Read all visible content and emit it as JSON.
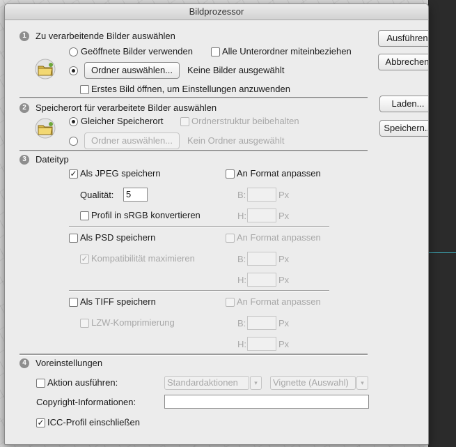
{
  "window": {
    "title": "Bildprozessor"
  },
  "side_buttons": {
    "run": "Ausführen",
    "cancel": "Abbrechen",
    "load": "Laden...",
    "save": "Speichern..."
  },
  "section1": {
    "number": "1",
    "title": "Zu verarbeitende Bilder auswählen",
    "open_images": "Geöffnete Bilder verwenden",
    "include_subfolders": "Alle Unterordner miteinbeziehen",
    "choose_folder": "Ordner auswählen...",
    "folder_status": "Keine Bilder ausgewählt",
    "open_first": "Erstes Bild öffnen, um Einstellungen anzuwenden"
  },
  "section2": {
    "number": "2",
    "title": "Speicherort für verarbeitete Bilder auswählen",
    "same_location": "Gleicher Speicherort",
    "keep_structure": "Ordnerstruktur beibehalten",
    "choose_folder": "Ordner auswählen...",
    "folder_status": "Kein Ordner ausgewählt"
  },
  "section3": {
    "number": "3",
    "title": "Dateityp",
    "jpeg": {
      "save": "Als JPEG speichern",
      "checked": true,
      "fit": "An Format anpassen",
      "quality_label": "Qualität:",
      "quality_value": "5",
      "profile": "Profil in sRGB konvertieren",
      "w_label": "B:",
      "h_label": "H:",
      "unit": "Px"
    },
    "psd": {
      "save": "Als PSD speichern",
      "fit": "An Format anpassen",
      "compat": "Kompatibilität maximieren",
      "w_label": "B:",
      "h_label": "H:",
      "unit": "Px"
    },
    "tiff": {
      "save": "Als TIFF speichern",
      "fit": "An Format anpassen",
      "lzw": "LZW-Komprimierung",
      "w_label": "B:",
      "h_label": "H:",
      "unit": "Px"
    }
  },
  "section4": {
    "number": "4",
    "title": "Voreinstellungen",
    "run_action": "Aktion ausführen:",
    "action_set": "Standardaktionen",
    "action": "Vignette (Auswahl)",
    "copyright_label": "Copyright-Informationen:",
    "copyright_value": "",
    "icc": "ICC-Profil einschließen"
  },
  "glyphs": {
    "check": "✓",
    "arrow": "▾"
  }
}
